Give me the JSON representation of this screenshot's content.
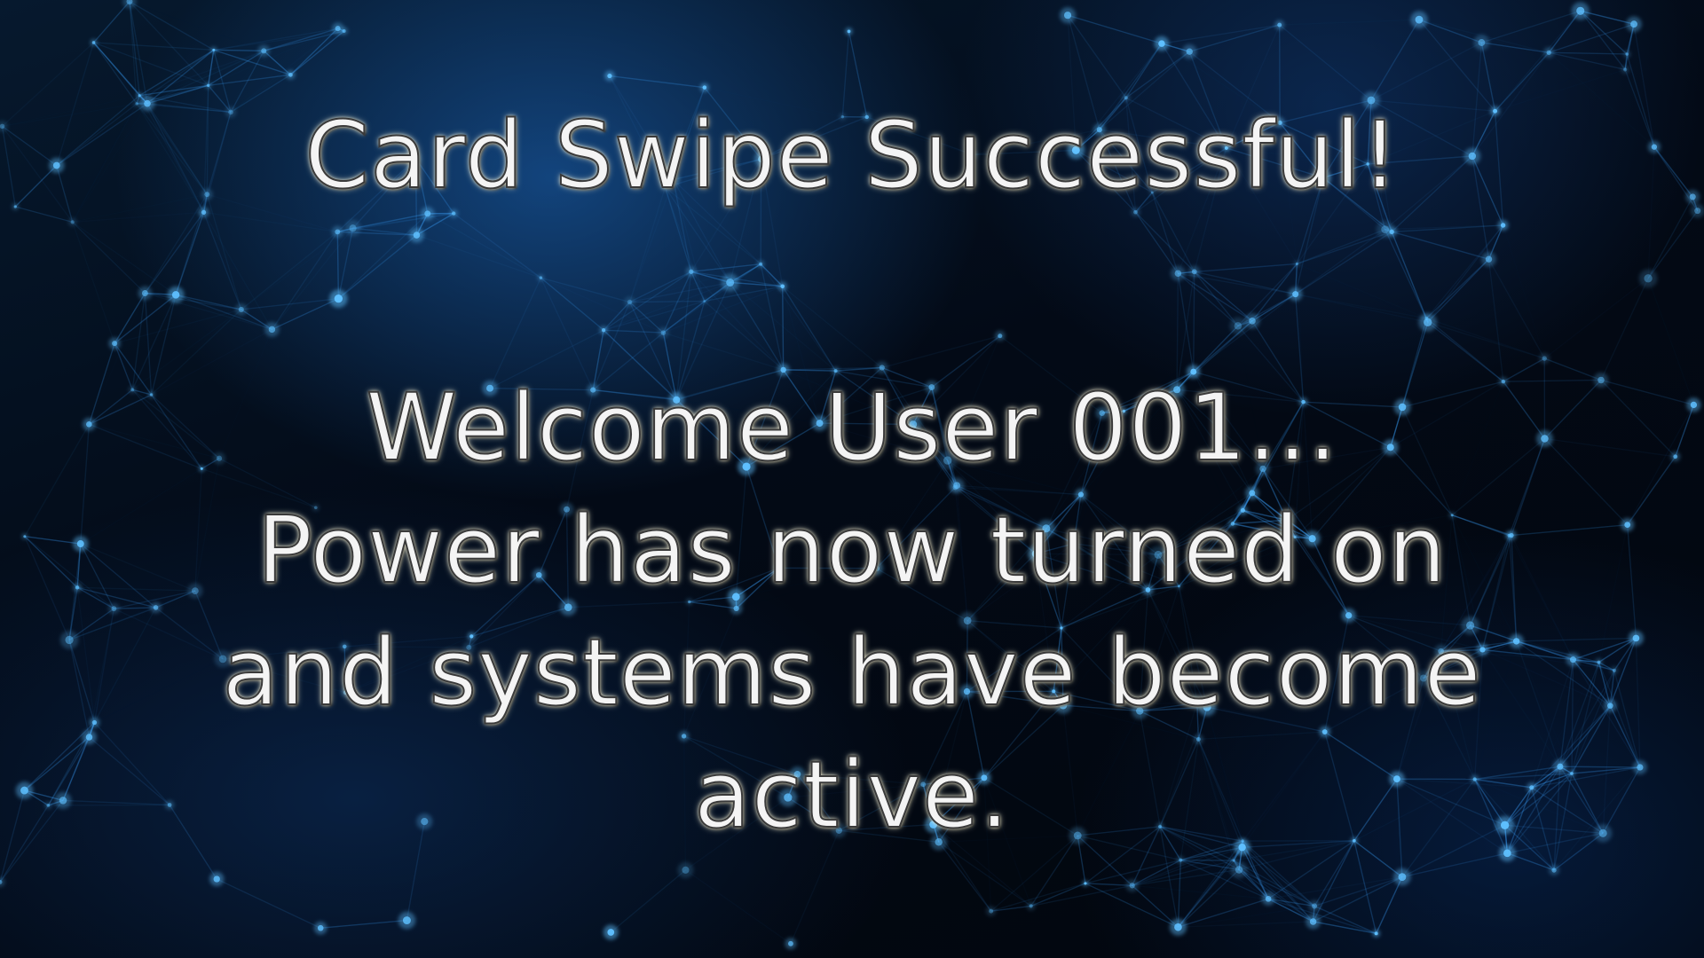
{
  "message": {
    "title": "Card Swipe Successful!",
    "lines": [
      "Welcome User 001...",
      "Power has now turned on",
      "and systems have become",
      "active."
    ]
  },
  "colors": {
    "text": "#f4f4f4",
    "text_outline": "#3a3a3a",
    "background": "#02070f",
    "network_line": "#3aa2ff",
    "network_node": "#5fc0ff"
  }
}
